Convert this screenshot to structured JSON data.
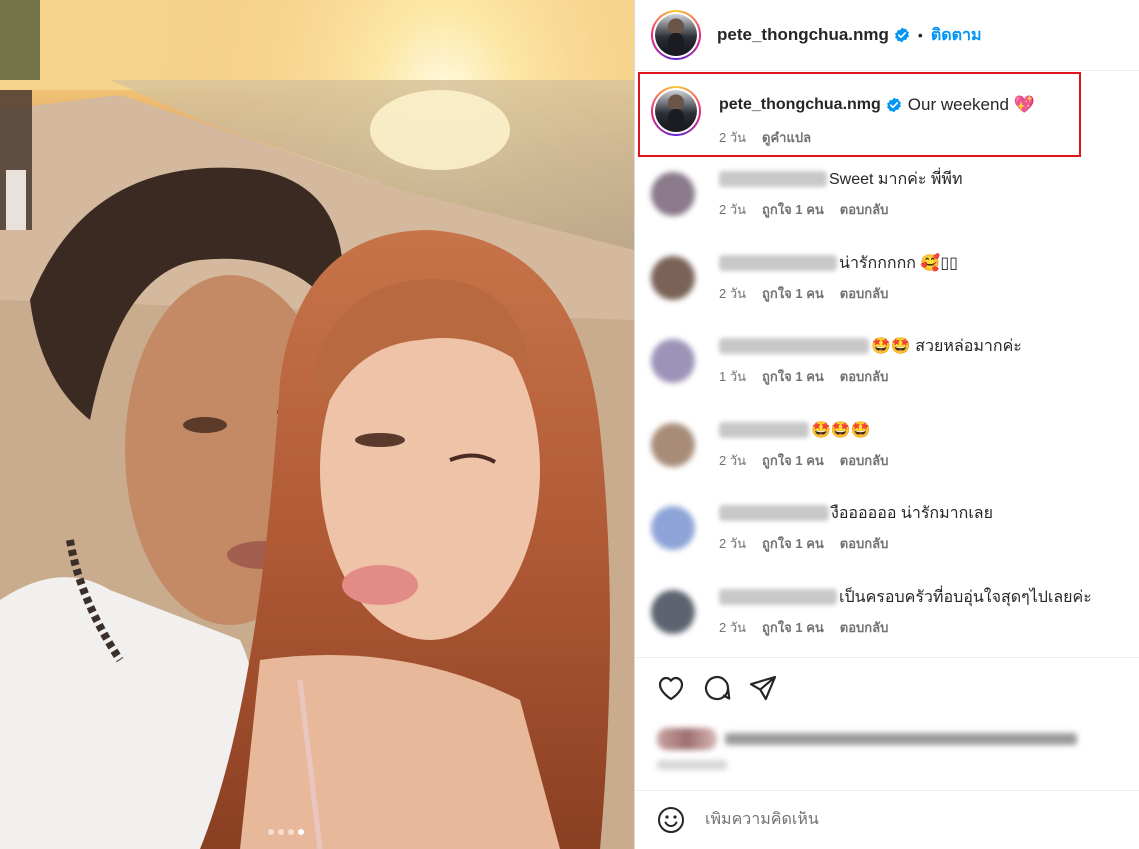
{
  "post": {
    "username": "pete_thongchua.nmg",
    "verified": true,
    "separator": "•",
    "follow_label": "ติดตาม",
    "caption_text": "Our weekend 💖",
    "caption_time": "2 วัน",
    "translate_label": "ดูคำแปล",
    "carousel": {
      "count": 4,
      "active_index": 3
    }
  },
  "comments": [
    {
      "text": "Sweet มากค่ะ พี่พีท",
      "time": "2 วัน",
      "likes": "ถูกใจ 1 คน",
      "reply": "ตอบกลับ",
      "avatar_color": "#8a7a8a"
    },
    {
      "text": "น่ารักกกกก 🥰▯▯",
      "time": "2 วัน",
      "likes": "ถูกใจ 1 คน",
      "reply": "ตอบกลับ",
      "avatar_color": "#7a6257"
    },
    {
      "text": "🤩🤩 สวยหล่อมากค่ะ",
      "time": "1 วัน",
      "likes": "ถูกใจ 1 คน",
      "reply": "ตอบกลับ",
      "avatar_color": "#9d93b8"
    },
    {
      "text": "🤩🤩🤩",
      "time": "2 วัน",
      "likes": "ถูกใจ 1 คน",
      "reply": "ตอบกลับ",
      "avatar_color": "#a88c78"
    },
    {
      "text": "งืออออออ น่ารักมากเลย",
      "time": "2 วัน",
      "likes": "ถูกใจ 1 คน",
      "reply": "ตอบกลับ",
      "avatar_color": "#8ea4d8"
    },
    {
      "text": "เป็นครอบครัวที่อบอุ่นใจสุดๆไปเลยค่ะ",
      "time": "2 วัน",
      "likes": "ถูกใจ 1 คน",
      "reply": "ตอบกลับ",
      "avatar_color": "#5d6470"
    }
  ],
  "actions": {
    "like_icon": "heart-icon",
    "comment_icon": "comment-icon",
    "share_icon": "send-icon"
  },
  "add_comment": {
    "placeholder": "เพิ่มความคิดเห็น",
    "emoji_icon": "smiley-icon"
  },
  "colors": {
    "follow": "#0095f6",
    "verified": "#0095f6",
    "highlight_box": "#e0141e",
    "meta_text": "#737373"
  }
}
